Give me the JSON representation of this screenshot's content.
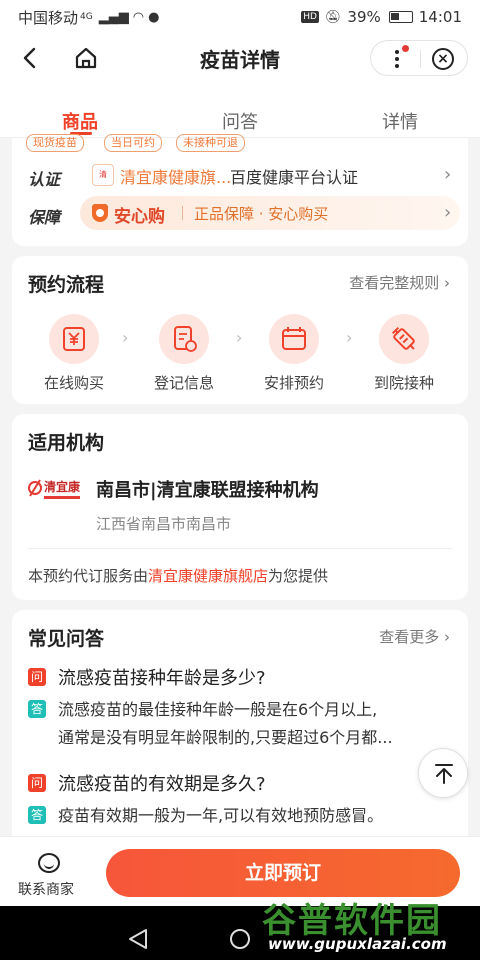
{
  "status_bar": {
    "carrier": "中国移动",
    "network": "4G",
    "battery": "39%",
    "time": "14:01"
  },
  "nav": {
    "title": "疫苗详情"
  },
  "tabs": [
    {
      "label": "商品",
      "active": true
    },
    {
      "label": "问答",
      "active": false
    },
    {
      "label": "详情",
      "active": false
    }
  ],
  "product": {
    "chips": [
      "现货疫苗",
      "当日可约",
      "未接种可退"
    ],
    "cert": {
      "label": "认证",
      "shop": "清宜康健康旗...",
      "platform": "百度健康平台认证"
    },
    "guarantee": {
      "label": "保障",
      "badge": "安心购",
      "text": "正品保障 · 安心购买"
    }
  },
  "flow": {
    "title": "预约流程",
    "more": "查看完整规则",
    "steps": [
      {
        "label": "在线购买",
        "icon": "yuan-icon"
      },
      {
        "label": "登记信息",
        "icon": "form-icon"
      },
      {
        "label": "安排预约",
        "icon": "calendar-icon"
      },
      {
        "label": "到院接种",
        "icon": "syringe-icon"
      }
    ]
  },
  "institution": {
    "title": "适用机构",
    "logo_text": "清宜康",
    "name": "南昌市|清宜康联盟接种机构",
    "address": "江西省南昌市南昌市",
    "provider_prefix": "本预约代订服务由",
    "provider_name": "清宜康健康旗舰店",
    "provider_suffix": "为您提供"
  },
  "faq": {
    "title": "常见问答",
    "more": "查看更多",
    "q_badge": "问",
    "a_badge": "答",
    "items": [
      {
        "q": "流感疫苗接种年龄是多少?",
        "a1": "流感疫苗的最佳接种年龄一般是在6个月以上,",
        "a2": "通常是没有明显年龄限制的,只要超过6个月都..."
      },
      {
        "q": "流感疫苗的有效期是多久?",
        "a1": "疫苗有效期一般为一年,可以有效地预防感冒。"
      }
    ]
  },
  "bottom": {
    "contact": "联系商家",
    "cta": "立即预订"
  },
  "watermark": {
    "title": "谷普软件园",
    "url": "www.gupuxlazai.com"
  }
}
